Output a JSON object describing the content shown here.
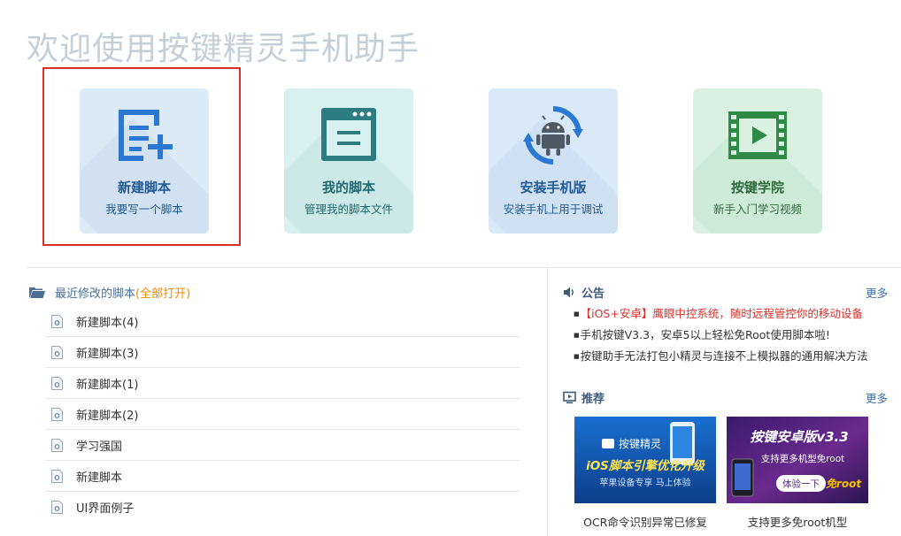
{
  "header": {
    "title": "欢迎使用按键精灵手机助手"
  },
  "cards": [
    {
      "title": "新建脚本",
      "subtitle": "我要写一个脚本",
      "icon": "new-script-icon",
      "selected": true
    },
    {
      "title": "我的脚本",
      "subtitle": "管理我的脚本文件",
      "icon": "my-scripts-icon"
    },
    {
      "title": "安装手机版",
      "subtitle": "安装手机上用于调试",
      "icon": "android-sync-icon"
    },
    {
      "title": "按键学院",
      "subtitle": "新手入门学习视频",
      "icon": "video-film-icon"
    }
  ],
  "recent": {
    "label": "最近修改的脚本",
    "open_all": "(全部打开)",
    "items": [
      "新建脚本(4)",
      "新建脚本(3)",
      "新建脚本(1)",
      "新建脚本(2)",
      "学习强国",
      "新建脚本",
      "UI界面例子"
    ]
  },
  "notice": {
    "label": "公告",
    "more": "更多",
    "items": [
      "【iOS+安卓】鹰眼中控系统，随时远程管控你的移动设备",
      "手机按键V3.3，安卓5以上轻松免Root使用脚本啦!",
      "按键助手无法打包小精灵与连接不上模拟器的通用解决方法"
    ]
  },
  "recommend": {
    "label": "推荐",
    "more": "更多",
    "items": [
      {
        "caption": "OCR命令识别异常已修复",
        "banner_brand": "按键精灵",
        "banner_title": "iOS脚本引擎优化升级",
        "banner_sub": "苹果设备专享 马上体验"
      },
      {
        "caption": "支持更多免root机型",
        "banner_title": "按键安卓版v3.3",
        "banner_sub": "支持更多机型免root",
        "banner_button": "体验一下",
        "banner_tag": "免root"
      }
    ]
  },
  "colors": {
    "accent_blue": "#2b78d4",
    "selection_red": "#d9302a",
    "open_all_orange": "#f08a00",
    "notice_hot_red": "#d9302a"
  }
}
